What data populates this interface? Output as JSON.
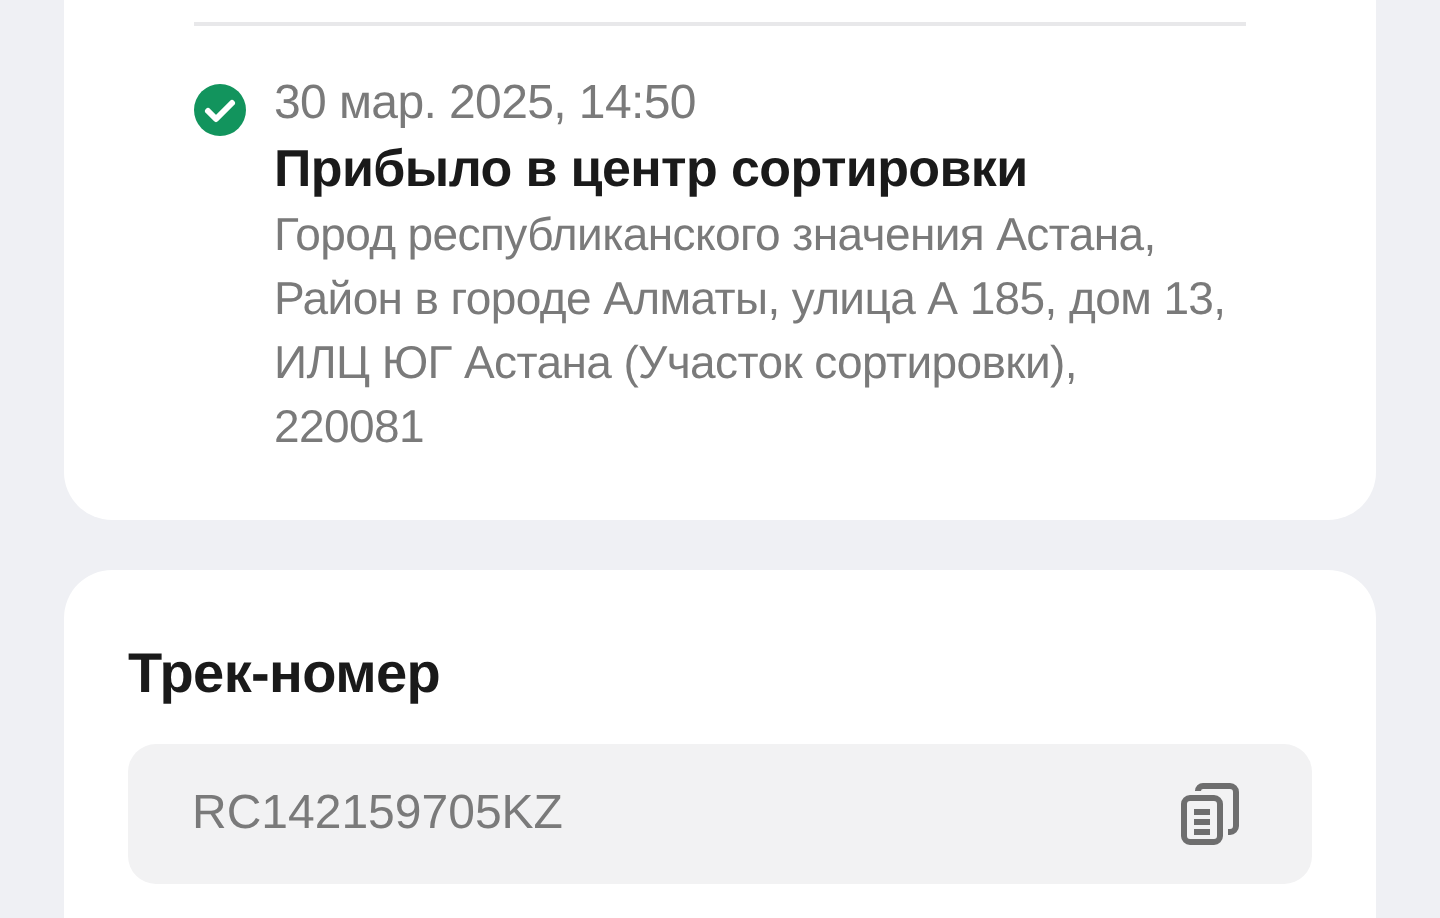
{
  "event": {
    "completed": true,
    "date": "30 мар. 2025, 14:50",
    "title": "Прибыло в центр сортировки",
    "address": "Город республиканского значения Астана, Район в городе Алматы, улица А 185, дом 13, ИЛЦ ЮГ Астана (Участок сортировки), 220081"
  },
  "tracking": {
    "heading": "Трек-номер",
    "value": "RC142159705KZ"
  }
}
